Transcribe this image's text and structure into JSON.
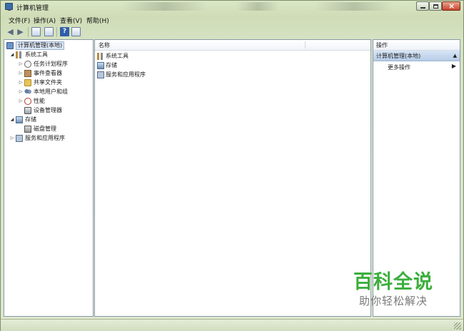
{
  "window": {
    "title": "计算机管理"
  },
  "menu": [
    "文件(F)",
    "操作(A)",
    "查看(V)",
    "帮助(H)"
  ],
  "toolbar": {
    "back_icon": "back-arrow-icon",
    "forward_icon": "forward-arrow-icon",
    "help_label": "?"
  },
  "tree": {
    "root": "计算机管理(本地)",
    "items": [
      {
        "label": "系统工具",
        "icon": "tools-icon",
        "level": 1,
        "expander": "expanded"
      },
      {
        "label": "任务计划程序",
        "icon": "task-scheduler-icon",
        "level": 2,
        "expander": "collapsed"
      },
      {
        "label": "事件查看器",
        "icon": "event-viewer-icon",
        "level": 2,
        "expander": "collapsed"
      },
      {
        "label": "共享文件夹",
        "icon": "shared-folder-icon",
        "level": 2,
        "expander": "collapsed"
      },
      {
        "label": "本地用户和组",
        "icon": "users-icon",
        "level": 2,
        "expander": "collapsed"
      },
      {
        "label": "性能",
        "icon": "performance-icon",
        "level": 2,
        "expander": "collapsed"
      },
      {
        "label": "设备管理器",
        "icon": "device-manager-icon",
        "level": 2,
        "expander": "none"
      },
      {
        "label": "存储",
        "icon": "storage-icon",
        "level": 1,
        "expander": "expanded"
      },
      {
        "label": "磁盘管理",
        "icon": "disk-icon",
        "level": 2,
        "expander": "none"
      },
      {
        "label": "服务和应用程序",
        "icon": "services-icon",
        "level": 1,
        "expander": "collapsed"
      }
    ]
  },
  "list": {
    "column_name": "名称",
    "rows": [
      "系统工具",
      "存储",
      "服务和应用程序"
    ]
  },
  "actions": {
    "header": "操作",
    "section": "计算机管理(本地)",
    "more_actions": "更多操作"
  },
  "watermark": {
    "main": "百科全说",
    "sub": "助你轻松解决"
  },
  "colors": {
    "window_frame": "#d7e3c4",
    "watermark_green": "#3cae3c"
  }
}
